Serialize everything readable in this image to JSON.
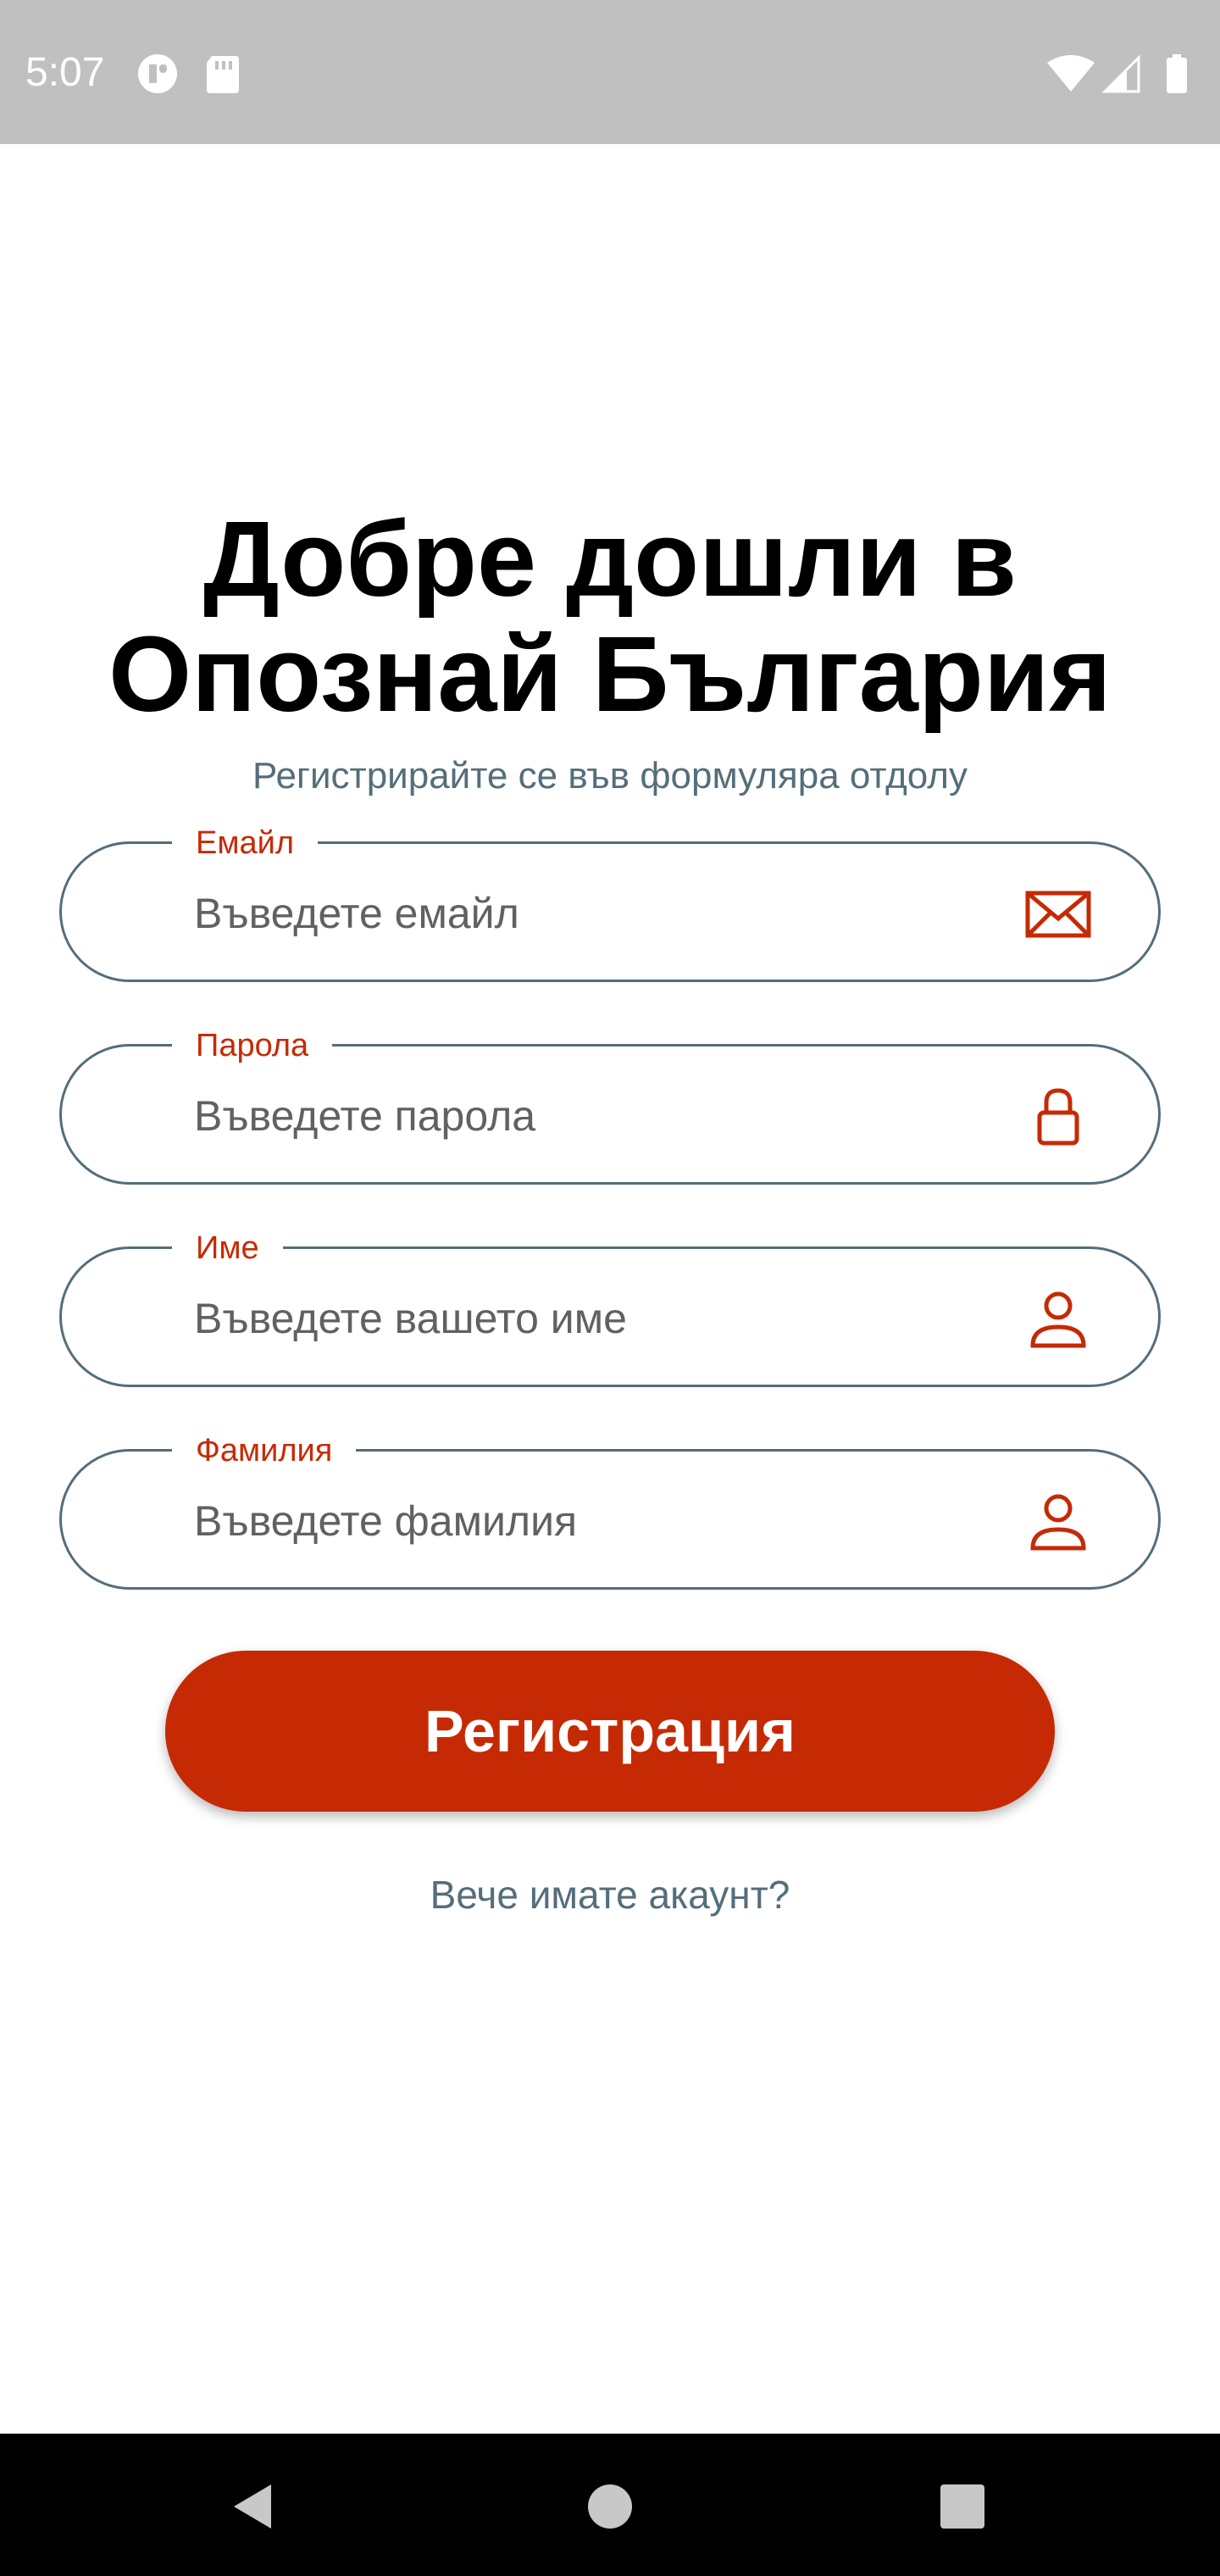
{
  "status_bar": {
    "time": "5:07",
    "icons": [
      "vpn-key-icon",
      "sd-card-icon",
      "wifi-icon",
      "signal-icon",
      "battery-icon"
    ]
  },
  "nav_bar": {
    "icons": [
      "back-icon",
      "home-icon",
      "recents-icon"
    ]
  },
  "welcome": {
    "title_line1": "Добре дошли в",
    "title_line2": "Опознай България",
    "subtitle": "Регистрирайте се във формуляра отдолу"
  },
  "form": {
    "email": {
      "label": "Емайл",
      "placeholder": "Въведете емайл",
      "value": "",
      "icon": "mail-icon"
    },
    "password": {
      "label": "Парола",
      "placeholder": "Въведете парола",
      "value": "",
      "icon": "lock-icon"
    },
    "first_name": {
      "label": "Име",
      "placeholder": "Въведете вашето име",
      "value": "",
      "icon": "person-icon"
    },
    "last_name": {
      "label": "Фамилия",
      "placeholder": "Въведете фамилия",
      "value": "",
      "icon": "person-icon"
    },
    "submit_label": "Регистрация",
    "login_link": "Вече имате акаунт?"
  },
  "colors": {
    "accent": "#C62A04",
    "border": "#546E7A",
    "secondary_text": "#546E7A",
    "status_bar": "#C0C0C0",
    "nav_bar": "#000000"
  }
}
